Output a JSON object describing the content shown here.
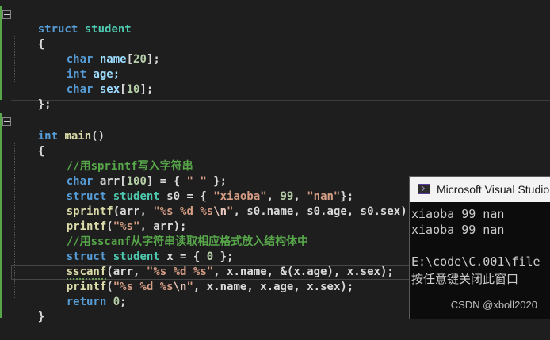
{
  "code": {
    "l1": [
      "struct",
      "student"
    ],
    "l2": "{",
    "l3": [
      "char",
      "name",
      "[",
      "20",
      "];"
    ],
    "l4": [
      "int",
      "age;"
    ],
    "l5": [
      "char",
      "sex",
      "[",
      "10",
      "];"
    ],
    "l6": "};",
    "l8": [
      "int",
      "main",
      "()"
    ],
    "l9": "{",
    "l10": "//用sprintf写入字符串",
    "l11": [
      "char",
      "arr",
      "[",
      "100",
      "] = {",
      "\" \"",
      "};"
    ],
    "l12": [
      "struct",
      "student",
      "s0",
      " = { ",
      "\"xiaoba\"",
      ", ",
      "99",
      ", ",
      "\"nan\"",
      "};"
    ],
    "l13": [
      "sprintf",
      "(arr, ",
      "\"%s %d %s",
      "\\n",
      "\"",
      ", ",
      "s0",
      ".name, ",
      "s0",
      ".age, ",
      "s0",
      ".sex);"
    ],
    "l14": [
      "printf",
      "(",
      "\"%s\"",
      ", arr);"
    ],
    "l15": "//用sscanf从字符串读取相应格式放入结构体中",
    "l16": [
      "struct",
      "student",
      "x",
      " = { ",
      "0",
      " };"
    ],
    "l17": [
      "sscanf",
      "(",
      "arr",
      ", ",
      "\"%s %d %s\"",
      ", ",
      "x",
      ".name, &(",
      "x",
      ".age), ",
      "x",
      ".sex);"
    ],
    "l18": [
      "printf",
      "(",
      "\"%s %d %s",
      "\\n",
      "\"",
      ", ",
      "x",
      ".name, ",
      "x",
      ".age, ",
      "x",
      ".sex);"
    ],
    "l19": [
      "return",
      "0",
      ";"
    ],
    "l20": "}"
  },
  "console": {
    "title": "Microsoft Visual Studio",
    "lines": [
      "xiaoba 99 nan",
      "xiaoba 99 nan",
      "",
      "E:\\code\\C.001\\file",
      "按任意键关闭此窗口"
    ]
  },
  "watermark": "CSDN @xboll2020"
}
